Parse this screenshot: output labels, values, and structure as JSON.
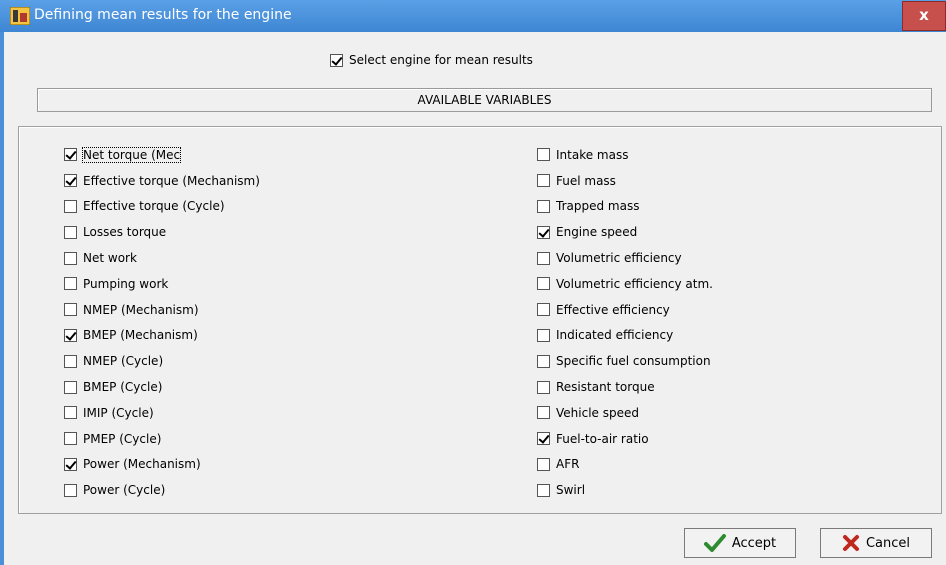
{
  "window": {
    "title": "Defining mean results for the engine",
    "close_label": "x"
  },
  "select_engine": {
    "label": "Select engine for mean results",
    "checked": true
  },
  "section_header": "AVAILABLE VARIABLES",
  "left_variables": [
    {
      "label": "Net torque (Mec",
      "checked": true,
      "focused": true
    },
    {
      "label": "Effective torque (Mechanism)",
      "checked": true
    },
    {
      "label": "Effective torque (Cycle)",
      "checked": false
    },
    {
      "label": "Losses torque",
      "checked": false
    },
    {
      "label": "Net work",
      "checked": false
    },
    {
      "label": "Pumping work",
      "checked": false
    },
    {
      "label": "NMEP (Mechanism)",
      "checked": false
    },
    {
      "label": "BMEP (Mechanism)",
      "checked": true
    },
    {
      "label": "NMEP (Cycle)",
      "checked": false
    },
    {
      "label": "BMEP (Cycle)",
      "checked": false
    },
    {
      "label": "IMIP (Cycle)",
      "checked": false
    },
    {
      "label": "PMEP (Cycle)",
      "checked": false
    },
    {
      "label": "Power (Mechanism)",
      "checked": true
    },
    {
      "label": "Power (Cycle)",
      "checked": false
    }
  ],
  "right_variables": [
    {
      "label": "Intake mass",
      "checked": false
    },
    {
      "label": "Fuel mass",
      "checked": false
    },
    {
      "label": "Trapped mass",
      "checked": false
    },
    {
      "label": "Engine speed",
      "checked": true
    },
    {
      "label": "Volumetric efficiency",
      "checked": false
    },
    {
      "label": "Volumetric efficiency atm.",
      "checked": false
    },
    {
      "label": "Effective efficiency",
      "checked": false
    },
    {
      "label": "Indicated efficiency",
      "checked": false
    },
    {
      "label": "Specific fuel consumption",
      "checked": false
    },
    {
      "label": "Resistant torque",
      "checked": false
    },
    {
      "label": "Vehicle speed",
      "checked": false
    },
    {
      "label": "Fuel-to-air ratio",
      "checked": true
    },
    {
      "label": "AFR",
      "checked": false
    },
    {
      "label": "Swirl",
      "checked": false
    }
  ],
  "buttons": {
    "accept_label": "Accept",
    "cancel_label": "Cancel",
    "accept_icon": "checkmark-icon",
    "cancel_icon": "cross-icon"
  },
  "colors": {
    "titlebar": "#4a90d9",
    "close_button": "#c7504c",
    "accept_check": "#2e8b2e",
    "cancel_cross": "#c0281e"
  }
}
